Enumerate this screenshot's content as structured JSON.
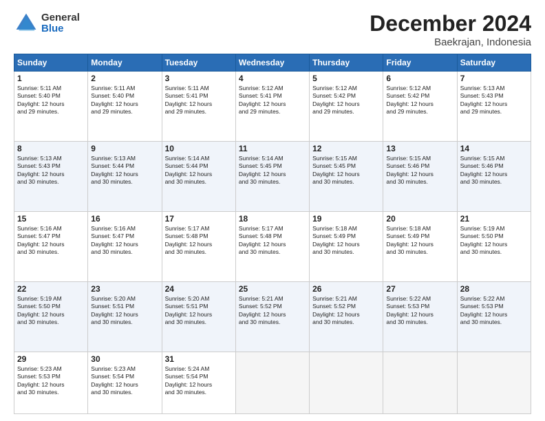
{
  "header": {
    "logo_general": "General",
    "logo_blue": "Blue",
    "title": "December 2024",
    "location": "Baekrajan, Indonesia"
  },
  "weekdays": [
    "Sunday",
    "Monday",
    "Tuesday",
    "Wednesday",
    "Thursday",
    "Friday",
    "Saturday"
  ],
  "weeks": [
    [
      {
        "day": "1",
        "info": "Sunrise: 5:11 AM\nSunset: 5:40 PM\nDaylight: 12 hours\nand 29 minutes."
      },
      {
        "day": "2",
        "info": "Sunrise: 5:11 AM\nSunset: 5:40 PM\nDaylight: 12 hours\nand 29 minutes."
      },
      {
        "day": "3",
        "info": "Sunrise: 5:11 AM\nSunset: 5:41 PM\nDaylight: 12 hours\nand 29 minutes."
      },
      {
        "day": "4",
        "info": "Sunrise: 5:12 AM\nSunset: 5:41 PM\nDaylight: 12 hours\nand 29 minutes."
      },
      {
        "day": "5",
        "info": "Sunrise: 5:12 AM\nSunset: 5:42 PM\nDaylight: 12 hours\nand 29 minutes."
      },
      {
        "day": "6",
        "info": "Sunrise: 5:12 AM\nSunset: 5:42 PM\nDaylight: 12 hours\nand 29 minutes."
      },
      {
        "day": "7",
        "info": "Sunrise: 5:13 AM\nSunset: 5:43 PM\nDaylight: 12 hours\nand 29 minutes."
      }
    ],
    [
      {
        "day": "8",
        "info": "Sunrise: 5:13 AM\nSunset: 5:43 PM\nDaylight: 12 hours\nand 30 minutes."
      },
      {
        "day": "9",
        "info": "Sunrise: 5:13 AM\nSunset: 5:44 PM\nDaylight: 12 hours\nand 30 minutes."
      },
      {
        "day": "10",
        "info": "Sunrise: 5:14 AM\nSunset: 5:44 PM\nDaylight: 12 hours\nand 30 minutes."
      },
      {
        "day": "11",
        "info": "Sunrise: 5:14 AM\nSunset: 5:45 PM\nDaylight: 12 hours\nand 30 minutes."
      },
      {
        "day": "12",
        "info": "Sunrise: 5:15 AM\nSunset: 5:45 PM\nDaylight: 12 hours\nand 30 minutes."
      },
      {
        "day": "13",
        "info": "Sunrise: 5:15 AM\nSunset: 5:46 PM\nDaylight: 12 hours\nand 30 minutes."
      },
      {
        "day": "14",
        "info": "Sunrise: 5:15 AM\nSunset: 5:46 PM\nDaylight: 12 hours\nand 30 minutes."
      }
    ],
    [
      {
        "day": "15",
        "info": "Sunrise: 5:16 AM\nSunset: 5:47 PM\nDaylight: 12 hours\nand 30 minutes."
      },
      {
        "day": "16",
        "info": "Sunrise: 5:16 AM\nSunset: 5:47 PM\nDaylight: 12 hours\nand 30 minutes."
      },
      {
        "day": "17",
        "info": "Sunrise: 5:17 AM\nSunset: 5:48 PM\nDaylight: 12 hours\nand 30 minutes."
      },
      {
        "day": "18",
        "info": "Sunrise: 5:17 AM\nSunset: 5:48 PM\nDaylight: 12 hours\nand 30 minutes."
      },
      {
        "day": "19",
        "info": "Sunrise: 5:18 AM\nSunset: 5:49 PM\nDaylight: 12 hours\nand 30 minutes."
      },
      {
        "day": "20",
        "info": "Sunrise: 5:18 AM\nSunset: 5:49 PM\nDaylight: 12 hours\nand 30 minutes."
      },
      {
        "day": "21",
        "info": "Sunrise: 5:19 AM\nSunset: 5:50 PM\nDaylight: 12 hours\nand 30 minutes."
      }
    ],
    [
      {
        "day": "22",
        "info": "Sunrise: 5:19 AM\nSunset: 5:50 PM\nDaylight: 12 hours\nand 30 minutes."
      },
      {
        "day": "23",
        "info": "Sunrise: 5:20 AM\nSunset: 5:51 PM\nDaylight: 12 hours\nand 30 minutes."
      },
      {
        "day": "24",
        "info": "Sunrise: 5:20 AM\nSunset: 5:51 PM\nDaylight: 12 hours\nand 30 minutes."
      },
      {
        "day": "25",
        "info": "Sunrise: 5:21 AM\nSunset: 5:52 PM\nDaylight: 12 hours\nand 30 minutes."
      },
      {
        "day": "26",
        "info": "Sunrise: 5:21 AM\nSunset: 5:52 PM\nDaylight: 12 hours\nand 30 minutes."
      },
      {
        "day": "27",
        "info": "Sunrise: 5:22 AM\nSunset: 5:53 PM\nDaylight: 12 hours\nand 30 minutes."
      },
      {
        "day": "28",
        "info": "Sunrise: 5:22 AM\nSunset: 5:53 PM\nDaylight: 12 hours\nand 30 minutes."
      }
    ],
    [
      {
        "day": "29",
        "info": "Sunrise: 5:23 AM\nSunset: 5:53 PM\nDaylight: 12 hours\nand 30 minutes."
      },
      {
        "day": "30",
        "info": "Sunrise: 5:23 AM\nSunset: 5:54 PM\nDaylight: 12 hours\nand 30 minutes."
      },
      {
        "day": "31",
        "info": "Sunrise: 5:24 AM\nSunset: 5:54 PM\nDaylight: 12 hours\nand 30 minutes."
      },
      null,
      null,
      null,
      null
    ]
  ]
}
